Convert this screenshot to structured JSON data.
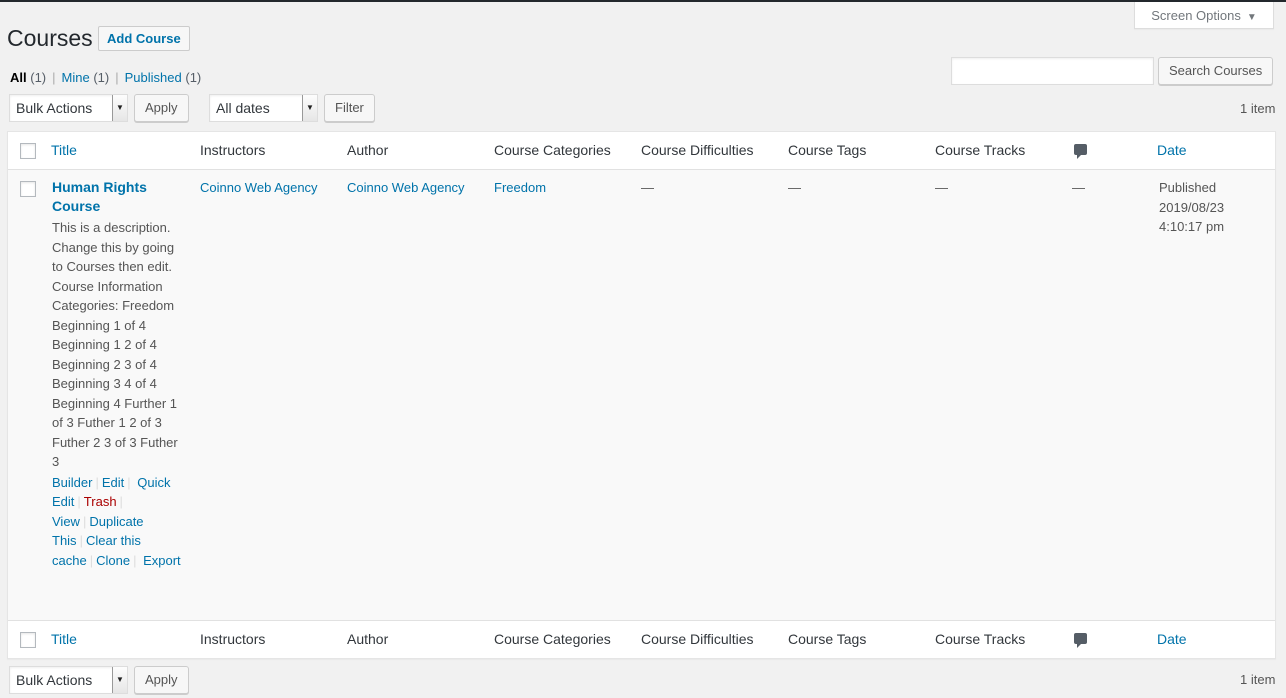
{
  "screen_options": {
    "label": "Screen Options",
    "arrow": "▼"
  },
  "page": {
    "title": "Courses",
    "add_button": "Add Course"
  },
  "views": {
    "all": {
      "label": "All",
      "count": "(1)"
    },
    "mine": {
      "label": "Mine",
      "count": "(1)"
    },
    "published": {
      "label": "Published",
      "count": "(1)"
    },
    "separator": "|"
  },
  "search": {
    "placeholder": "",
    "button": "Search Courses"
  },
  "top_nav": {
    "bulk_actions": "Bulk Actions",
    "apply": "Apply",
    "dates": "All dates",
    "filter": "Filter",
    "items": "1 item"
  },
  "columns": {
    "title": "Title",
    "instructors": "Instructors",
    "author": "Author",
    "categories": "Course Categories",
    "difficulties": "Course Difficulties",
    "tags": "Course Tags",
    "tracks": "Course Tracks",
    "comments_icon": "comment-icon",
    "date": "Date"
  },
  "row": {
    "title": "Human Rights Course",
    "description": "This is a description. Change this by going to Courses then edit. Course Information Categories: Freedom Beginning 1 of 4 Beginning 1 2 of 4 Beginning 2 3 of 4 Beginning 3 4 of 4 Beginning 4 Further 1 of 3 Futher 1 2 of 3 Futher 2 3 of 3 Futher 3",
    "actions": {
      "builder": "Builder",
      "edit": "Edit",
      "quick_edit": "Quick Edit",
      "trash": "Trash",
      "view": "View",
      "duplicate": "Duplicate This",
      "clear_cache": "Clear this cache",
      "clone": "Clone",
      "export": "Export",
      "separator": "|"
    },
    "instructors": "Coinno Web Agency",
    "author": "Coinno Web Agency",
    "categories": "Freedom",
    "difficulties": "—",
    "tags": "—",
    "tracks": "—",
    "comments": "—",
    "date_status": "Published",
    "date_day": "2019/08/23",
    "date_time": "4:10:17 pm"
  },
  "bottom_nav": {
    "bulk_actions": "Bulk Actions",
    "apply": "Apply",
    "items": "1 item"
  },
  "colors": {
    "link": "#0073aa",
    "trash": "#aa0000",
    "background": "#f1f1f1"
  }
}
